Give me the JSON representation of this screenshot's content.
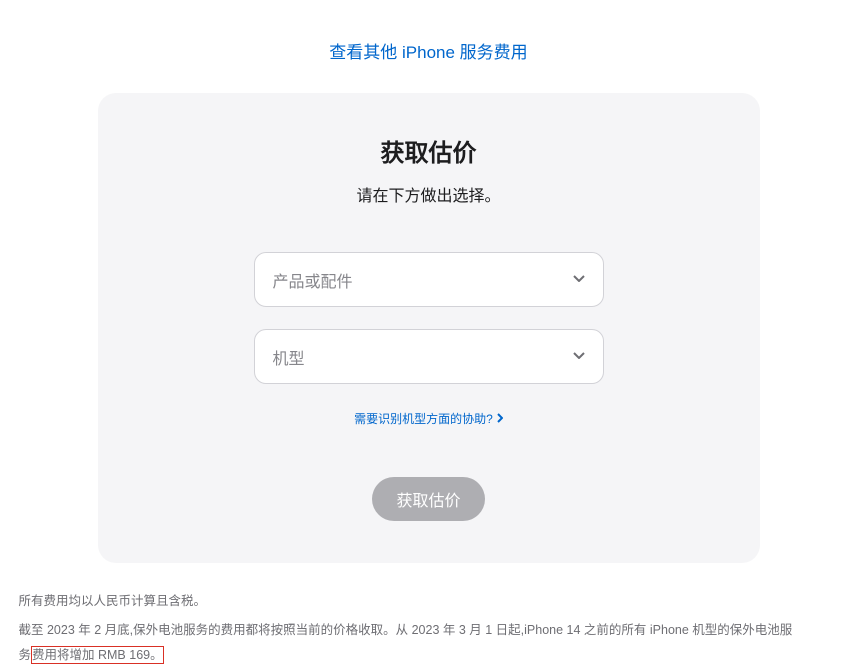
{
  "top_link": "查看其他 iPhone 服务费用",
  "card": {
    "title": "获取估价",
    "subtitle": "请在下方做出选择。",
    "select1_placeholder": "产品或配件",
    "select2_placeholder": "机型",
    "help_link": "需要识别机型方面的协助?",
    "button": "获取估价"
  },
  "footnote": {
    "line1": "所有费用均以人民币计算且含税。",
    "line2_a": "截至 2023 年 2 月底,保外电池服务的费用都将按照当前的价格收取。从 2023 年 3 月 1 日起,iPhone 14 之前的所有 iPhone 机型的保外电池服",
    "line2_b": "务",
    "line2_highlight": "费用将增加 RMB 169。"
  }
}
